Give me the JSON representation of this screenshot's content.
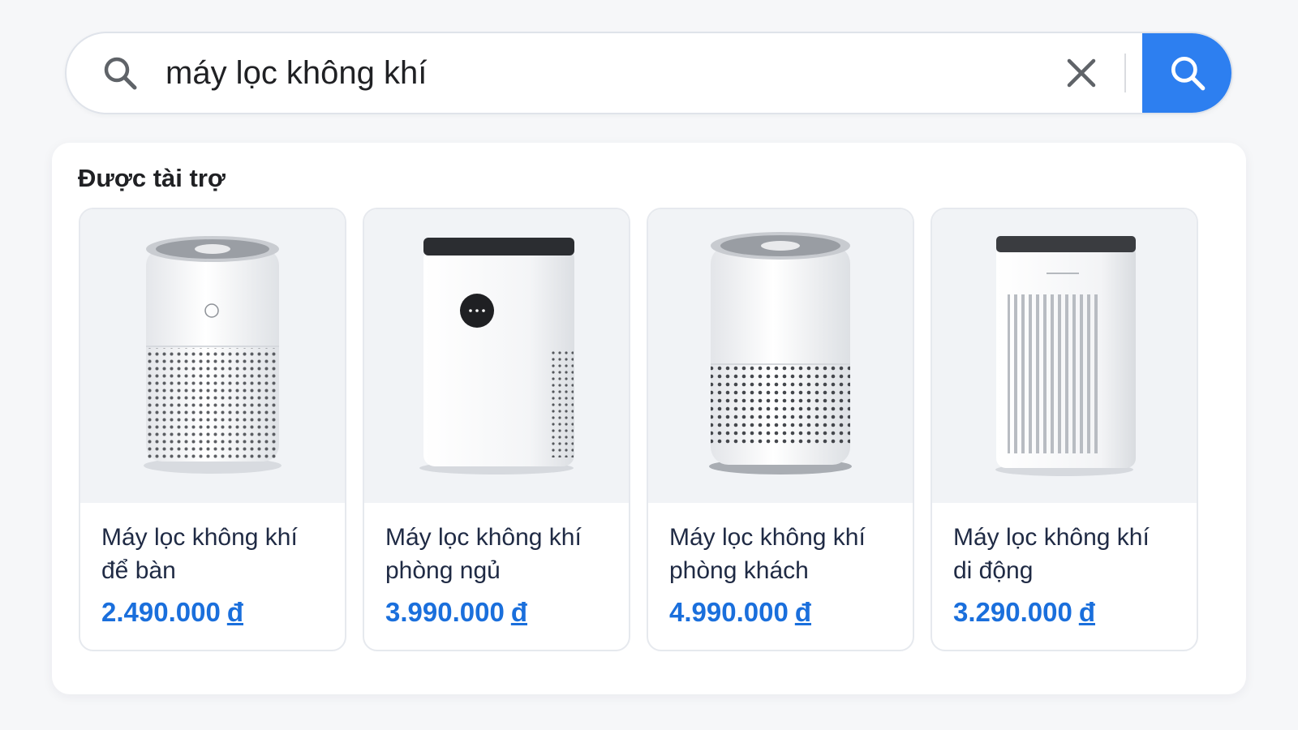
{
  "search": {
    "query": "máy lọc không khí",
    "icons": {
      "leading": "search-icon",
      "clear": "close-icon",
      "submit": "search-icon"
    },
    "accent_color": "#2d7ff0"
  },
  "sponsored": {
    "title": "Được tài trợ",
    "products": [
      {
        "title_line1": "Máy lọc không khí",
        "title_line2": "để bàn",
        "price": "2.490.000",
        "currency": "đ",
        "image": "cylinder-purifier-small"
      },
      {
        "title_line1": "Máy lọc không khí",
        "title_line2": "phòng ngủ",
        "price": "3.990.000",
        "currency": "đ",
        "image": "box-purifier-display"
      },
      {
        "title_line1": "Máy lọc không khí",
        "title_line2": "phòng khách",
        "price": "4.990.000",
        "currency": "đ",
        "image": "cylinder-purifier-large"
      },
      {
        "title_line1": "Máy lọc không khí",
        "title_line2": "di động",
        "price": "3.290.000",
        "currency": "đ",
        "image": "tower-purifier-slats"
      }
    ],
    "price_color": "#1a6fdc"
  }
}
